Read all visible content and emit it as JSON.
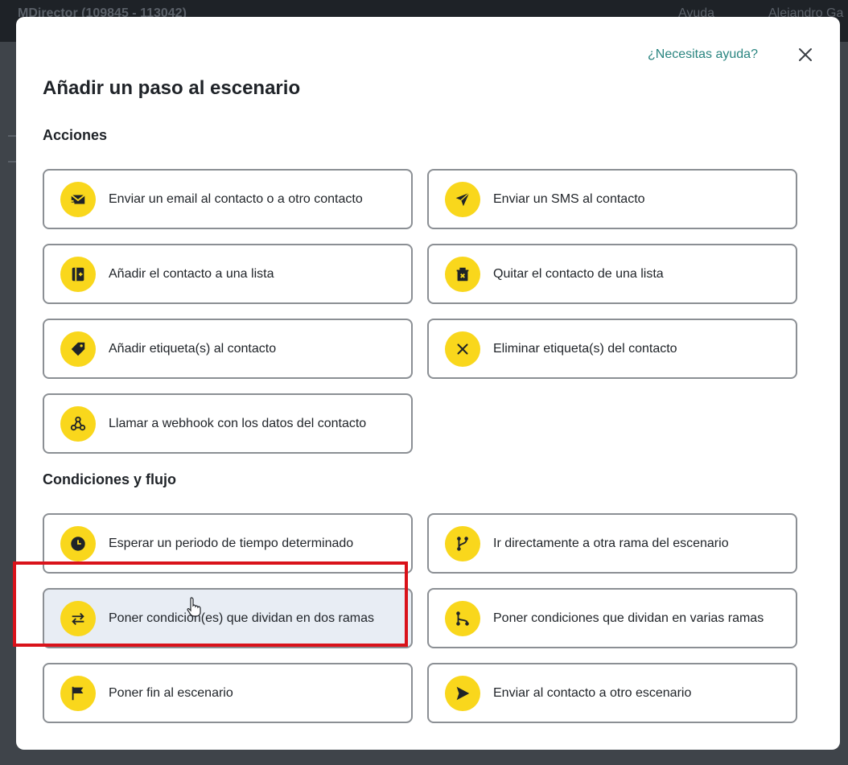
{
  "background": {
    "app_title": "MDirector (109845 - 113042)",
    "help_menu": "Ayuda",
    "user_name": "Alejandro Ga"
  },
  "modal": {
    "help_link": "¿Necesitas ayuda?",
    "title": "Añadir un paso al escenario",
    "sections": [
      {
        "title": "Acciones",
        "items": [
          {
            "label": "Enviar un email al contacto o a otro contacto",
            "icon": "email-icon"
          },
          {
            "label": "Enviar un SMS al contacto",
            "icon": "send-arrow-icon"
          },
          {
            "label": "Añadir el contacto a una lista",
            "icon": "add-to-list-icon"
          },
          {
            "label": "Quitar el contacto de una lista",
            "icon": "remove-from-list-icon"
          },
          {
            "label": "Añadir etiqueta(s) al contacto",
            "icon": "tag-icon"
          },
          {
            "label": "Eliminar etiqueta(s) del contacto",
            "icon": "close-icon"
          },
          {
            "label": "Llamar a webhook con los datos del contacto",
            "icon": "webhook-icon"
          }
        ]
      },
      {
        "title": "Condiciones y flujo",
        "items": [
          {
            "label": "Esperar un periodo de tiempo determinado",
            "icon": "clock-icon"
          },
          {
            "label": "Ir directamente a otra rama del escenario",
            "icon": "branch-icon"
          },
          {
            "label": "Poner condición(es) que dividan en dos ramas",
            "icon": "swap-arrows-icon"
          },
          {
            "label": "Poner condiciones que dividan en varias ramas",
            "icon": "multi-branch-icon"
          },
          {
            "label": "Poner fin al escenario",
            "icon": "flag-icon"
          },
          {
            "label": "Enviar al contacto a otro escenario",
            "icon": "play-send-icon"
          }
        ]
      }
    ]
  },
  "colors": {
    "accent_yellow": "#f9d71c",
    "link_teal": "#2a8580",
    "highlight_red": "#d9121a",
    "hover_bg": "#e8edf4"
  }
}
